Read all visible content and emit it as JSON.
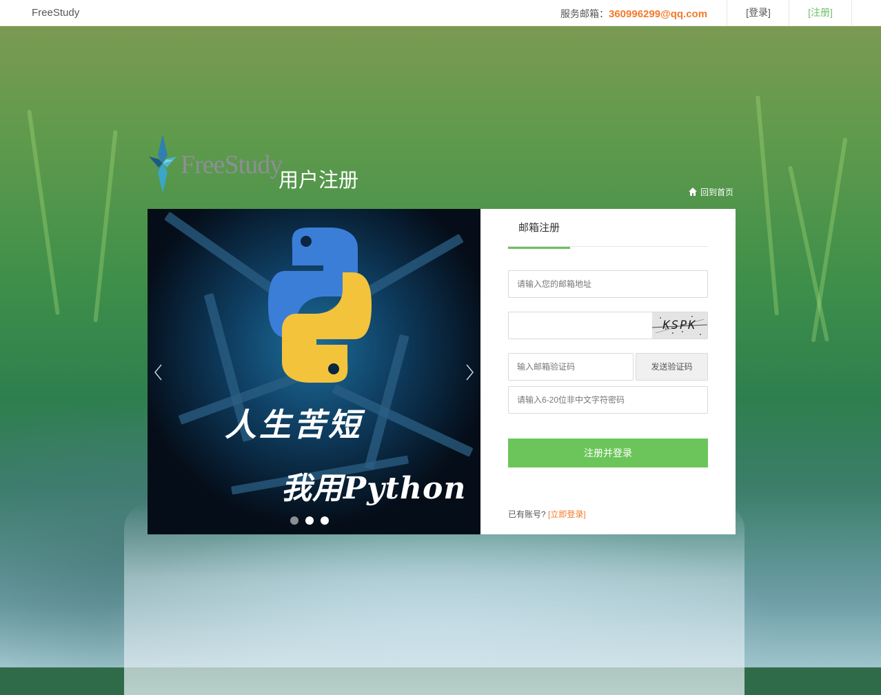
{
  "topbar": {
    "brand": "FreeStudy",
    "service_label": "服务邮箱：",
    "service_email": "360996299@qq.com",
    "login": "[登录]",
    "register": "[注册]"
  },
  "header": {
    "logo_text": "FreeStudy",
    "title": "用户注册",
    "back_home": "回到首页"
  },
  "carousel": {
    "slogan_line1": "人生苦短",
    "slogan_line2": "我用Python",
    "active_slide": 2,
    "slide_count": 3
  },
  "form": {
    "tab_label": "邮箱注册",
    "email_placeholder": "请输入您的邮箱地址",
    "captcha_value": "",
    "captcha_text": "KSPK",
    "code_placeholder": "输入邮箱验证码",
    "send_code_label": "发送验证码",
    "password_placeholder": "请输入6-20位非中文字符密码",
    "submit_label": "注册并登录",
    "have_account": "已有账号?",
    "login_now": "[立即登录]"
  },
  "colors": {
    "accent_green": "#6cc55a",
    "accent_orange": "#f5792a"
  },
  "icons": {
    "home": "home-icon",
    "prev": "chevron-left-icon",
    "next": "chevron-right-icon"
  }
}
